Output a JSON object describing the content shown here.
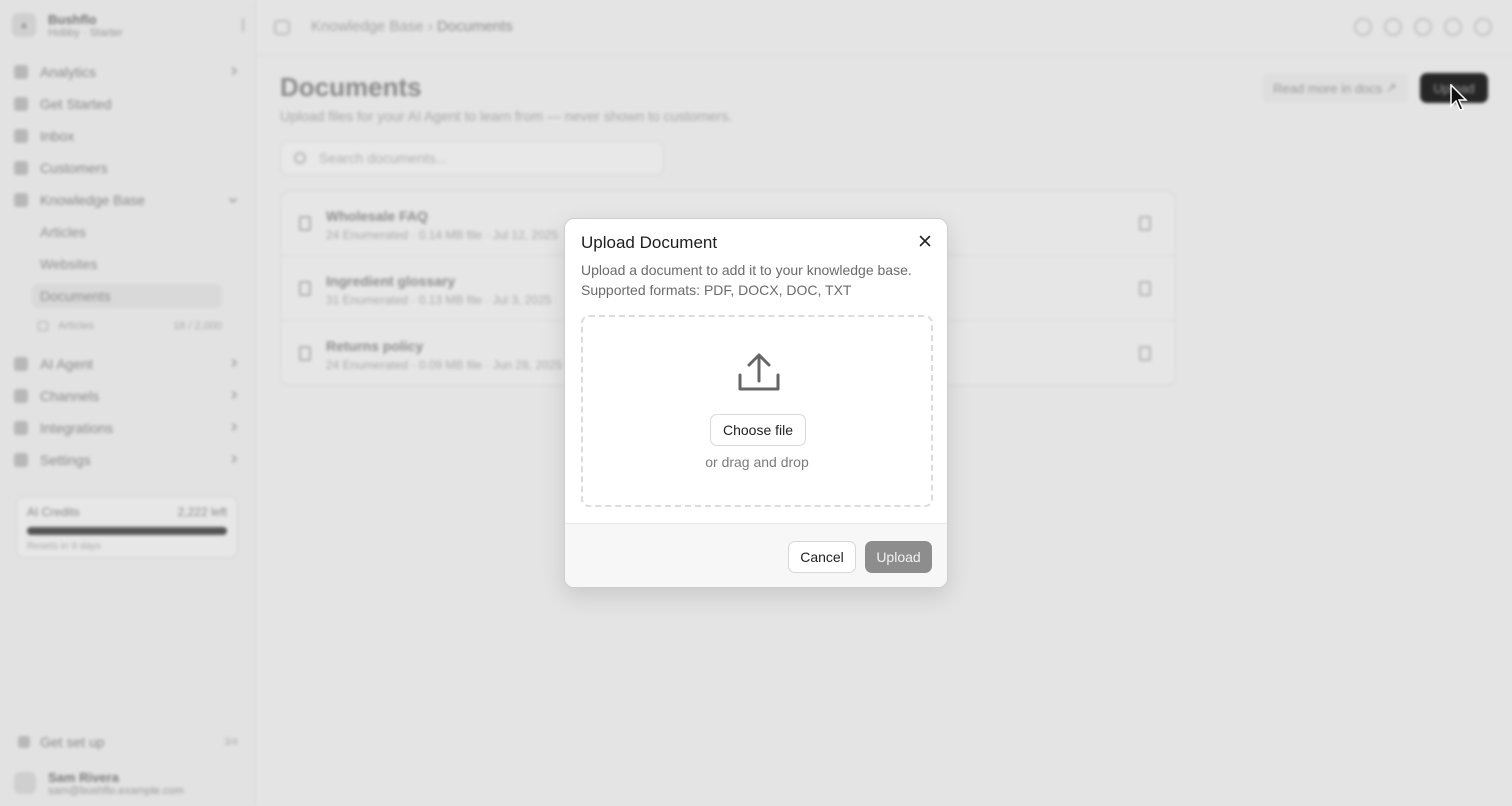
{
  "app": {
    "workspace": {
      "name": "Bushflo",
      "plan": "Hobby · Starter"
    },
    "nav": [
      {
        "label": "Analytics"
      },
      {
        "label": "Get Started"
      },
      {
        "label": "Inbox"
      },
      {
        "label": "Customers"
      },
      {
        "label": "Knowledge Base"
      }
    ],
    "kb_sub": [
      {
        "label": "Articles"
      },
      {
        "label": "Websites"
      },
      {
        "label": "Documents"
      }
    ],
    "kb_meta": {
      "label": "Articles",
      "count": "18 / 2,000"
    },
    "nav2": [
      {
        "label": "AI Agent"
      },
      {
        "label": "Channels"
      },
      {
        "label": "Integrations"
      },
      {
        "label": "Settings"
      }
    ],
    "credits": {
      "label": "AI Credits",
      "value": "2,222 left",
      "fill": 1.0,
      "sub": "Resets in 9 days"
    },
    "setup": {
      "label": "Get set up",
      "kbd": "3/4"
    },
    "user": {
      "name": "Sam Rivera",
      "email": "sam@bushflo.example.com"
    },
    "breadcrumb": {
      "parent": "Knowledge Base",
      "current": "Documents"
    },
    "page": {
      "title": "Documents",
      "subtitle": "Upload files for your AI Agent to learn from — never shown to customers.",
      "docs_link": "Read more in docs",
      "upload_label": "Upload",
      "search_placeholder": "Search documents..."
    },
    "documents": [
      {
        "name": "Wholesale FAQ",
        "meta": "24 Enumerated · 0.14 MB file · Jul 12, 2025"
      },
      {
        "name": "Ingredient glossary",
        "meta": "31 Enumerated · 0.13 MB file · Jul 3, 2025"
      },
      {
        "name": "Returns policy",
        "meta": "24 Enumerated · 0.09 MB file · Jun 28, 2025"
      }
    ]
  },
  "modal": {
    "title": "Upload Document",
    "description_line1": "Upload a document to add it to your knowledge base.",
    "description_line2": "Supported formats: PDF, DOCX, DOC, TXT",
    "choose_file": "Choose file",
    "drag_text": "or drag and drop",
    "cancel": "Cancel",
    "upload": "Upload"
  }
}
